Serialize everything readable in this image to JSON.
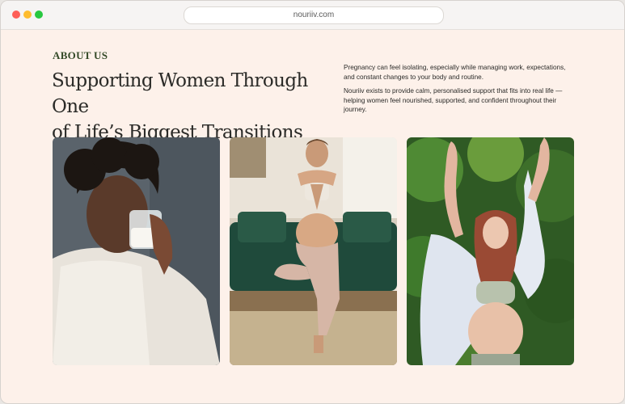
{
  "browser": {
    "url": "nouriiv.com"
  },
  "about": {
    "eyebrow": "ABOUT US",
    "headline_line1": "Supporting Women Through One",
    "headline_line2": "of Life’s Biggest Transitions",
    "paragraph1": "Pregnancy can feel isolating, especially while managing work, expectations, and constant changes to your body and routine.",
    "paragraph2": "Nouriiv exists to provide calm, personalised support that fits into real life — helping women feel nourished, supported, and confident throughout their journey."
  },
  "colors": {
    "page_background": "#fdf1ea",
    "eyebrow": "#344a28",
    "heading": "#2b2b28"
  },
  "images": [
    {
      "name": "woman-drinking-milk-photo"
    },
    {
      "name": "pregnant-woman-yoga-photo"
    },
    {
      "name": "pregnant-woman-outdoors-photo"
    }
  ]
}
